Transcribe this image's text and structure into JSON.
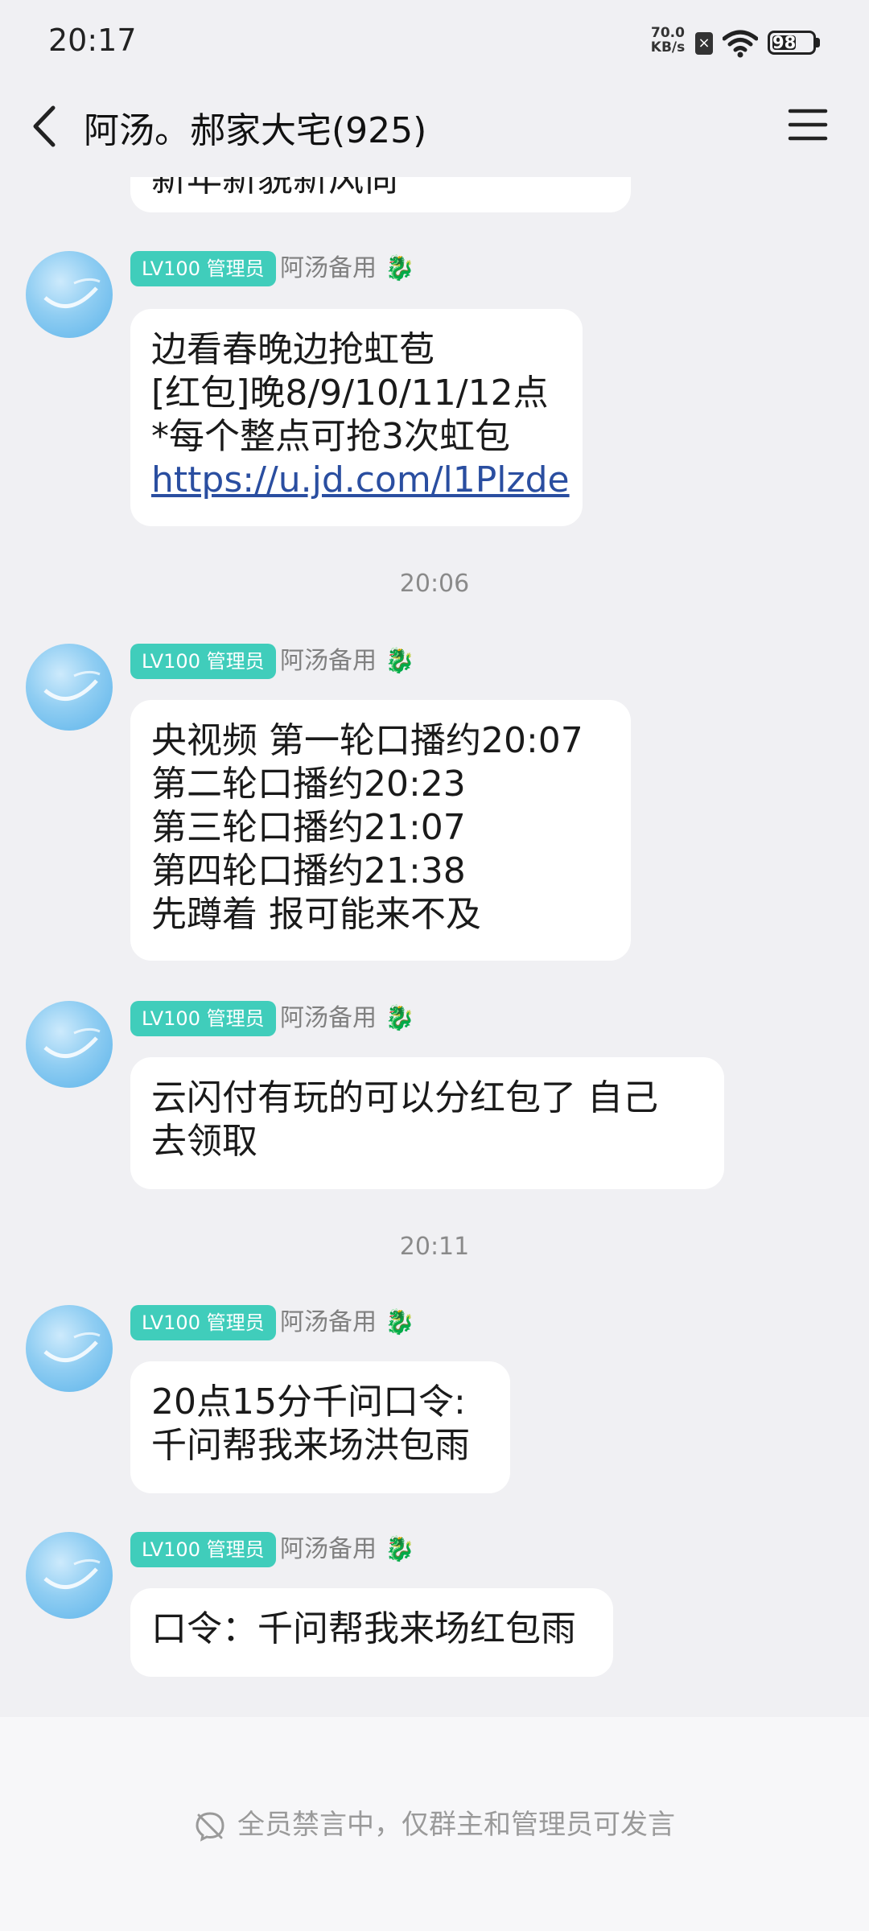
{
  "status_bar": {
    "time": "20:17",
    "net_speed_value": "70.0",
    "net_speed_unit": "KB/s",
    "battery": "98",
    "icons": [
      "sim-off-icon",
      "wifi-icon",
      "battery-icon"
    ]
  },
  "header": {
    "title": "阿汤。郝家大宅(925)",
    "back_icon": "chevron-left-icon",
    "menu_icon": "hamburger-menu-icon"
  },
  "partial_top_message": "新年新貌新风尚",
  "messages": [
    {
      "badge": "LV100 管理员",
      "sender": "阿汤备用",
      "sender_emoji": "🐉",
      "lines": [
        "边看春晚边抢虹苞",
        "[红包]晚8/9/10/11/12点",
        "*每个整点可抢3次虹包"
      ],
      "link": "https://u.jd.com/l1Plzde"
    },
    {
      "badge": "LV100 管理员",
      "sender": "阿汤备用",
      "sender_emoji": "🐉",
      "lines": [
        "央视频   第一轮口播约20:07",
        "第二轮口播约20:23",
        "第三轮口播约21:07",
        "第四轮口播约21:38",
        "先蹲着 报可能来不及"
      ]
    },
    {
      "badge": "LV100 管理员",
      "sender": "阿汤备用",
      "sender_emoji": "🐉",
      "lines": [
        "云闪付有玩的可以分红包了  自己",
        "去领取"
      ]
    },
    {
      "badge": "LV100 管理员",
      "sender": "阿汤备用",
      "sender_emoji": "🐉",
      "lines": [
        "20点15分千问口令:",
        "千问帮我来场洪包雨"
      ]
    },
    {
      "badge": "LV100 管理员",
      "sender": "阿汤备用",
      "sender_emoji": "🐉",
      "lines": [
        "口令：千问帮我来场红包雨"
      ]
    }
  ],
  "time_separators": [
    "20:06",
    "20:11"
  ],
  "footer": {
    "icon": "mute-icon",
    "note": "全员禁言中，仅群主和管理员可发言"
  }
}
